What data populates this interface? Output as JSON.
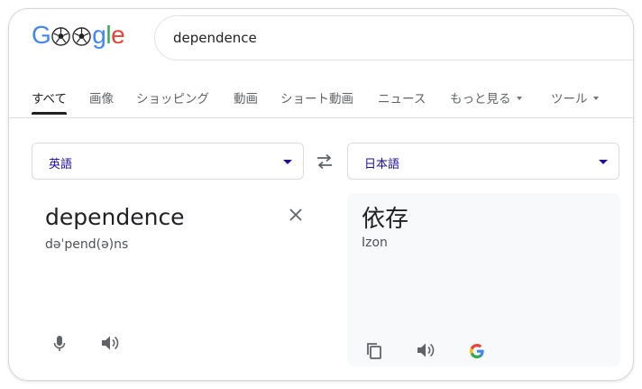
{
  "search": {
    "query": "dependence"
  },
  "tabs": [
    {
      "label": "すべて",
      "active": true
    },
    {
      "label": "画像"
    },
    {
      "label": "ショッピング"
    },
    {
      "label": "動画"
    },
    {
      "label": "ショート動画"
    },
    {
      "label": "ニュース"
    },
    {
      "label": "もっと見る",
      "dropdown": true
    },
    {
      "label": "ツール",
      "dropdown": true
    }
  ],
  "translate": {
    "source_lang": "英語",
    "target_lang": "日本語",
    "source_text": "dependence",
    "source_phonetic": "dəˈpend(ə)ns",
    "target_text": "依存",
    "target_romanization": "Izon"
  },
  "colors": {
    "link": "#1a0dab",
    "google_blue": "#4285f4",
    "google_red": "#ea4335",
    "google_yellow": "#fbbc05",
    "google_green": "#34a853"
  },
  "icons": [
    "soccer-ball-icon",
    "swap-icon",
    "close-icon",
    "microphone-icon",
    "speaker-icon",
    "copy-icon",
    "google-g-icon",
    "dropdown-arrow-icon"
  ]
}
